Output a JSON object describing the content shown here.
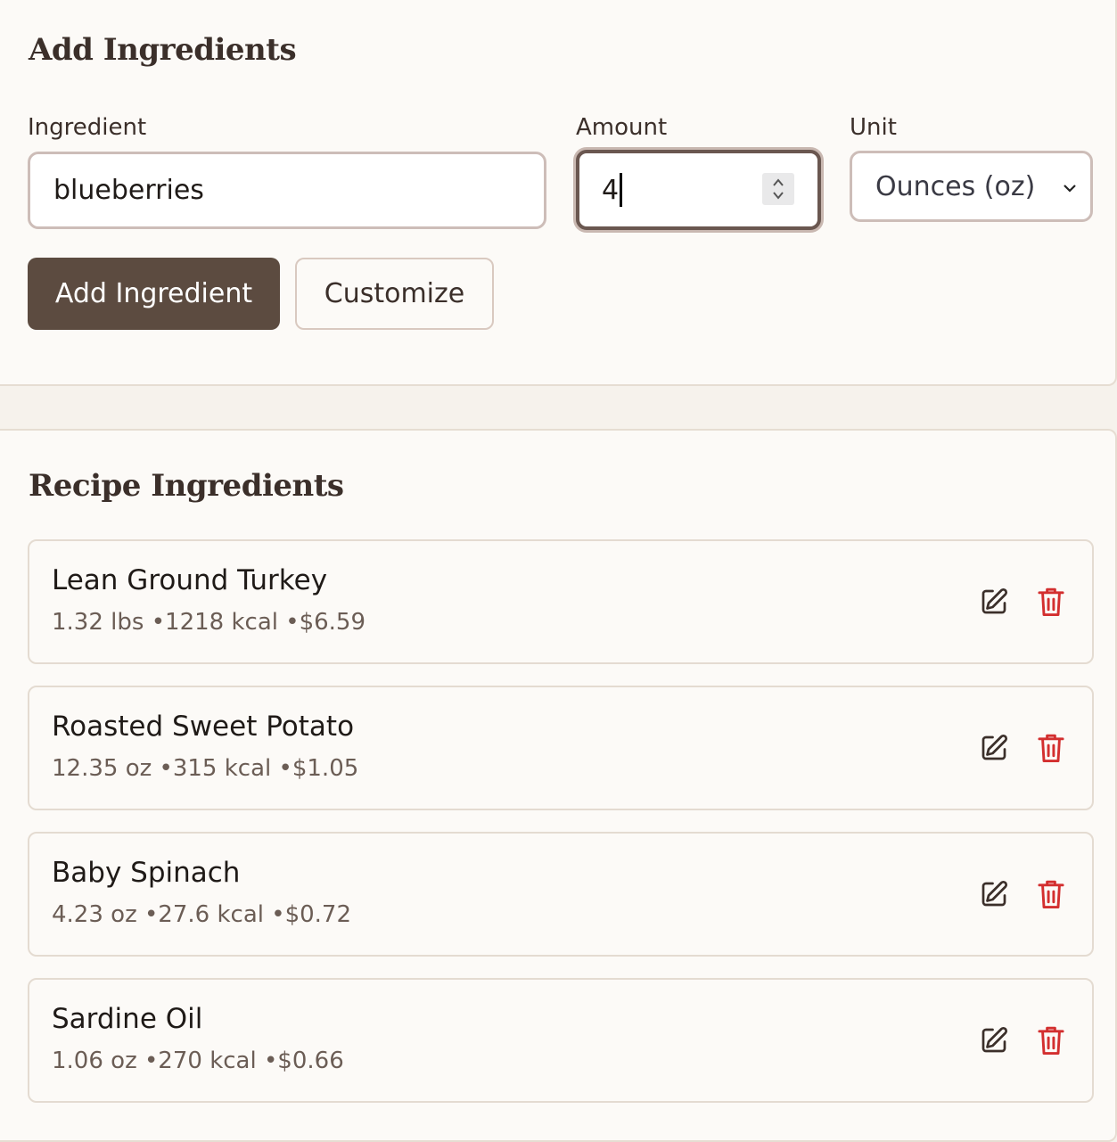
{
  "add_section": {
    "title": "Add Ingredients",
    "ingredient_label": "Ingredient",
    "ingredient_value": "blueberries",
    "amount_label": "Amount",
    "amount_value": "4",
    "unit_label": "Unit",
    "unit_selected": "Ounces (oz)",
    "add_button": "Add Ingredient",
    "customize_button": "Customize"
  },
  "recipe_section": {
    "title": "Recipe Ingredients",
    "items": [
      {
        "name": "Lean Ground Turkey",
        "details": "1.32 lbs •1218 kcal •$6.59"
      },
      {
        "name": "Roasted Sweet Potato",
        "details": "12.35 oz •315 kcal •$1.05"
      },
      {
        "name": "Baby Spinach",
        "details": "4.23 oz •27.6 kcal •$0.72"
      },
      {
        "name": "Sardine Oil",
        "details": "1.06 oz •270 kcal •$0.66"
      }
    ]
  },
  "icons": {
    "edit": "edit-icon",
    "delete": "trash-icon"
  },
  "colors": {
    "primary_button": "#5c4b40",
    "delete_icon": "#d32f2f",
    "edit_icon": "#3b2f2a",
    "background": "#fcfaf7"
  }
}
